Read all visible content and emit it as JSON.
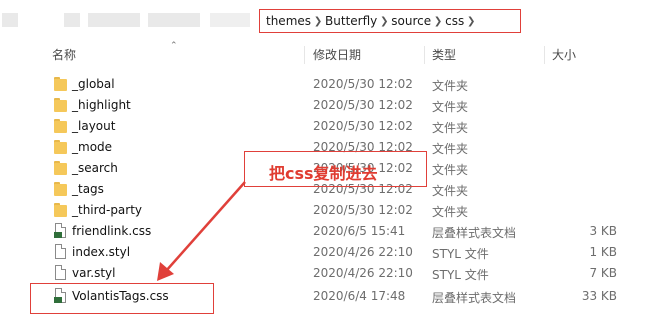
{
  "breadcrumb": [
    "themes",
    "Butterfly",
    "source",
    "css"
  ],
  "columns": {
    "name": "名称",
    "modified": "修改日期",
    "type": "类型",
    "size": "大小"
  },
  "rows": [
    {
      "name": "_global",
      "date": "2020/5/30 12:02",
      "type": "文件夹",
      "size": "",
      "icon": "folder-icon"
    },
    {
      "name": "_highlight",
      "date": "2020/5/30 12:02",
      "type": "文件夹",
      "size": "",
      "icon": "folder-icon"
    },
    {
      "name": "_layout",
      "date": "2020/5/30 12:02",
      "type": "文件夹",
      "size": "",
      "icon": "folder-icon"
    },
    {
      "name": "_mode",
      "date": "2020/5/30 12:02",
      "type": "文件夹",
      "size": "",
      "icon": "folder-icon"
    },
    {
      "name": "_search",
      "date": "2020/5/30 12:02",
      "type": "文件夹",
      "size": "",
      "icon": "folder-icon"
    },
    {
      "name": "_tags",
      "date": "2020/5/30 12:02",
      "type": "文件夹",
      "size": "",
      "icon": "folder-icon"
    },
    {
      "name": "_third-party",
      "date": "2020/5/30 12:02",
      "type": "文件夹",
      "size": "",
      "icon": "folder-icon"
    },
    {
      "name": "friendlink.css",
      "date": "2020/6/5 15:41",
      "type": "层叠样式表文档",
      "size": "3 KB",
      "icon": "css-file-icon"
    },
    {
      "name": "index.styl",
      "date": "2020/4/26 22:10",
      "type": "STYL 文件",
      "size": "1 KB",
      "icon": "file-icon"
    },
    {
      "name": "var.styl",
      "date": "2020/4/26 22:10",
      "type": "STYL 文件",
      "size": "7 KB",
      "icon": "file-icon"
    },
    {
      "name": "VolantisTags.css",
      "date": "2020/6/4 17:48",
      "type": "层叠样式表文档",
      "size": "33 KB",
      "icon": "css-file-icon"
    }
  ],
  "annotation": {
    "text": "把css复制进去",
    "color": "#e03c31"
  }
}
